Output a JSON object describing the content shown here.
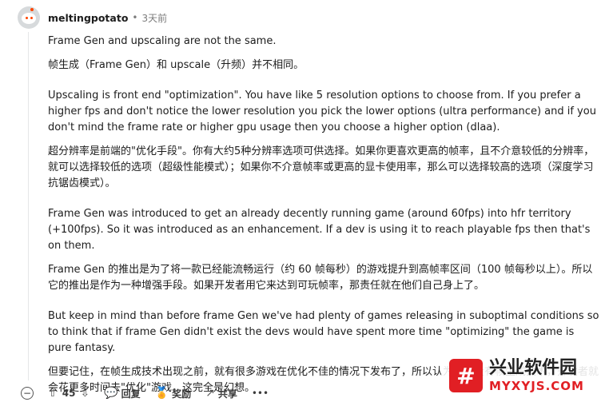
{
  "comment": {
    "username": "meltingpotato",
    "separator": "•",
    "time": "3天前",
    "paragraphs": [
      "Frame Gen and upscaling are not the same.",
      "帧生成（Frame Gen）和 upscale（升频）并不相同。",
      "Upscaling is front end \"optimization\". You have like 5 resolution options to choose from. If you prefer a higher fps and don't notice the lower resolution you pick the lower options (ultra performance) and if you don't mind the frame rate or higher gpu usage then you choose a higher option (dlaa).",
      "超分辨率是前端的\"优化手段\"。你有大约5种分辨率选项可供选择。如果你更喜欢更高的帧率，且不介意较低的分辨率，就可以选择较低的选项（超级性能模式）；如果你不介意帧率或更高的显卡使用率，那么可以选择较高的选项（深度学习抗锯齿模式）。",
      "Frame Gen was introduced to get an already decently running game (around 60fps) into hfr territory (+100fps). So it was introduced as an enhancement. If a dev is using it to reach playable fps then that's on them.",
      "Frame Gen 的推出是为了将一款已经能流畅运行（约 60 帧每秒）的游戏提升到高帧率区间（100 帧每秒以上）。所以它的推出是作为一种增强手段。如果开发者用它来达到可玩帧率，那责任就在他们自己身上了。",
      "But keep in mind than before frame Gen we've had plenty of games releasing in suboptimal conditions so to think that if frame Gen didn't exist the devs would have spent more time \"optimizing\" the game is pure fantasy.",
      "但要记住，在帧生成技术出现之前，就有很多游戏在优化不佳的情况下发布了，所以认为如果没有帧生成技术，开发者就会花更多时间去\"优化\"游戏，这完全是幻想。"
    ]
  },
  "actions": {
    "score": "45",
    "reply_label": "回复",
    "award_label": "奖励",
    "share_label": "共享",
    "more_label": "•••"
  },
  "icons": {
    "collapse": "minus-circle-icon",
    "upvote": "arrow-up-icon",
    "downvote": "arrow-down-icon",
    "reply": "speech-bubble-icon",
    "award": "award-icon",
    "share": "share-icon"
  },
  "watermark": {
    "logo_char": "#",
    "text_cn": "兴业软件园",
    "text_en": "MYXYJS.COM"
  },
  "colors": {
    "accent": "#ff4500",
    "watermark_red": "#e11f24",
    "muted_text": "#7c7c7c"
  }
}
